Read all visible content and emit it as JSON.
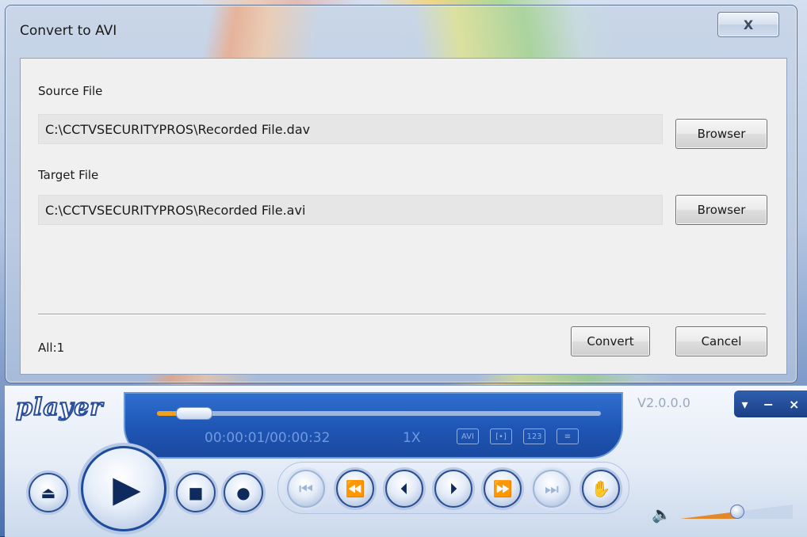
{
  "dialog": {
    "title": "Convert to AVI",
    "close_glyph": "X",
    "source_label": "Source File",
    "source_value": "C:\\CCTVSECURITYPROS\\Recorded File.dav",
    "source_button": "Browser",
    "target_label": "Target File",
    "target_value": "C:\\CCTVSECURITYPROS\\Recorded File.avi",
    "target_button": "Browser",
    "count_text": "All:1",
    "convert_button": "Convert",
    "cancel_button": "Cancel"
  },
  "player": {
    "logo": "player",
    "version": "V2.0.0.0",
    "time": "00:00:01/00:00:32",
    "speed": "1X",
    "progress": 0.03,
    "volume": 0.5,
    "mini_icons": [
      "avi-icon",
      "snapshot-icon",
      "number-icon",
      "list-icon"
    ],
    "mini_icon_labels": [
      "AVI",
      "[•]",
      "123",
      "≡"
    ],
    "window_controls": [
      "▾",
      "−",
      "×"
    ],
    "accent": "#f0a020",
    "controls": [
      {
        "name": "eject-button",
        "glyph": "⏏"
      },
      {
        "name": "play-button",
        "glyph": "▶"
      },
      {
        "name": "stop-button",
        "glyph": "■"
      },
      {
        "name": "record-button",
        "glyph": "●"
      },
      {
        "name": "prev-file-button",
        "glyph": "⏮"
      },
      {
        "name": "rewind-button",
        "glyph": "⏪"
      },
      {
        "name": "step-back-button",
        "glyph": "⏴"
      },
      {
        "name": "step-forward-button",
        "glyph": "⏵"
      },
      {
        "name": "fast-forward-button",
        "glyph": "⏩"
      },
      {
        "name": "next-file-button",
        "glyph": "⏭"
      },
      {
        "name": "hand-button",
        "glyph": "✋"
      }
    ]
  }
}
